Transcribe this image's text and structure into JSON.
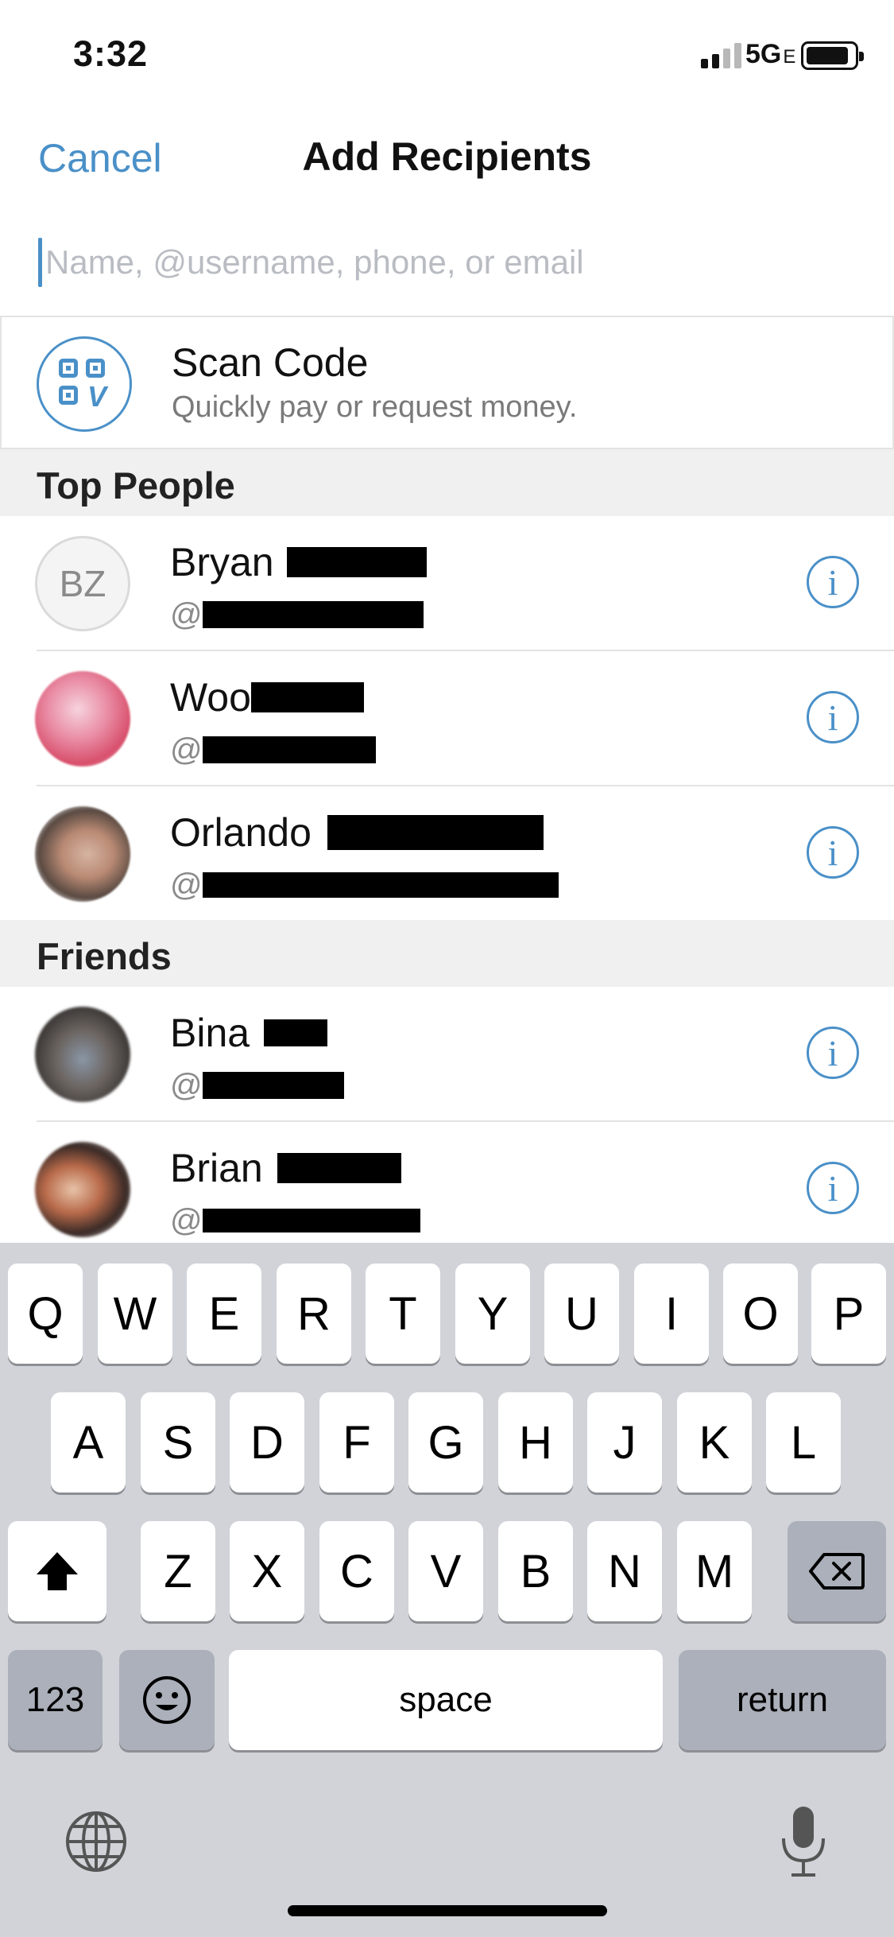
{
  "status_bar": {
    "time": "3:32",
    "network": "5G",
    "network_suffix": "E"
  },
  "nav": {
    "cancel_label": "Cancel",
    "title": "Add Recipients"
  },
  "search": {
    "placeholder": "Name, @username, phone, or email",
    "value": ""
  },
  "scan": {
    "title": "Scan Code",
    "subtitle": "Quickly pay or request money.",
    "icon": "qr-code-icon"
  },
  "sections": {
    "top_people": {
      "label": "Top People",
      "items": [
        {
          "name": "Bryan",
          "initials": "BZ",
          "handle_prefix": "@"
        },
        {
          "name": "Woo",
          "handle_prefix": "@"
        },
        {
          "name": "Orlando",
          "handle_prefix": "@"
        }
      ]
    },
    "friends": {
      "label": "Friends",
      "items": [
        {
          "name": "Bina",
          "handle_prefix": "@"
        },
        {
          "name": "Brian",
          "handle_prefix": "@"
        }
      ]
    }
  },
  "info_icon_glyph": "i",
  "keyboard": {
    "row1": [
      "Q",
      "W",
      "E",
      "R",
      "T",
      "Y",
      "U",
      "I",
      "O",
      "P"
    ],
    "row2": [
      "A",
      "S",
      "D",
      "F",
      "G",
      "H",
      "J",
      "K",
      "L"
    ],
    "row3": [
      "Z",
      "X",
      "C",
      "V",
      "B",
      "N",
      "M"
    ],
    "numbers_label": "123",
    "space_label": "space",
    "return_label": "return"
  },
  "colors": {
    "accent": "#4a90c8",
    "section_bg": "#f0f0f0",
    "keyboard_bg": "#d1d3d9"
  }
}
